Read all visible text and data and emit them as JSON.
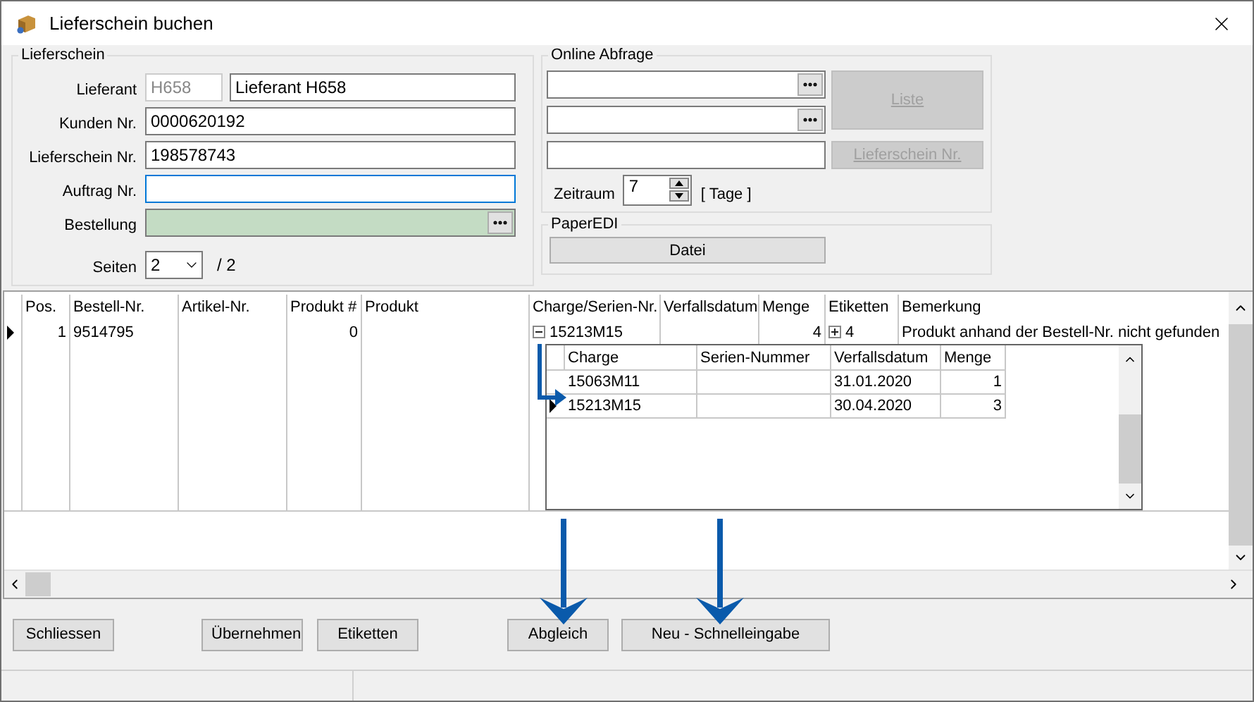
{
  "window": {
    "title": "Lieferschein buchen"
  },
  "lieferschein": {
    "title": "Lieferschein",
    "lieferant": {
      "label": "Lieferant",
      "code": "H658",
      "value": "Lieferant H658"
    },
    "kunden_nr": {
      "label": "Kunden Nr.",
      "value": "0000620192"
    },
    "lieferschein_nr": {
      "label": "Lieferschein Nr.",
      "value": "198578743"
    },
    "auftrag_nr": {
      "label": "Auftrag Nr.",
      "focused": true
    },
    "bestellung": {
      "label": "Bestellung",
      "highlighted": true
    },
    "seiten": {
      "label": "Seiten",
      "value": "2",
      "total": "/ 2"
    }
  },
  "online_abfrage": {
    "title": "Online Abfrage",
    "fields": [
      {
        "kind": "picker"
      },
      {
        "kind": "picker"
      },
      {
        "kind": "text"
      }
    ],
    "buttons": [
      {
        "label": "Liste",
        "disabled": true
      },
      {
        "label": "Lieferschein Nr.",
        "disabled": true
      }
    ],
    "zeitraum": {
      "label": "Zeitraum",
      "value": "7",
      "unit": "[ Tage ]"
    }
  },
  "paper_edi": {
    "title": "PaperEDI",
    "button": "Datei"
  },
  "table": {
    "columns": [
      "Pos.",
      "Bestell-Nr.",
      "Artikel-Nr.",
      "Produkt #",
      "Produkt",
      "Charge/Serien-Nr.",
      "Verfallsdatum",
      "Menge",
      "Etiketten",
      "Bemerkung"
    ],
    "rows": [
      {
        "selected": true,
        "charge_expanded": true,
        "etiketten_expanded": false,
        "cells": [
          "1",
          "9514795",
          null,
          "0",
          null,
          "15213M15",
          null,
          "4",
          "4",
          "Produkt anhand der Bestell-Nr. nicht gefunden"
        ]
      }
    ],
    "detail": {
      "columns": [
        "Charge",
        "Serien-Nummer",
        "Verfallsdatum",
        "Menge"
      ],
      "rows": [
        {
          "selected": false,
          "cells": [
            "15063M11",
            null,
            "31.01.2020",
            "1"
          ]
        },
        {
          "selected": true,
          "cells": [
            "15213M15",
            null,
            "30.04.2020",
            "3"
          ]
        }
      ]
    }
  },
  "buttons": [
    {
      "label": "Schliessen"
    },
    {
      "label": "Übernehmen"
    },
    {
      "label": "Etiketten"
    },
    {
      "label": "Abgleich"
    },
    {
      "label": "Neu - Schnelleingabe"
    }
  ]
}
